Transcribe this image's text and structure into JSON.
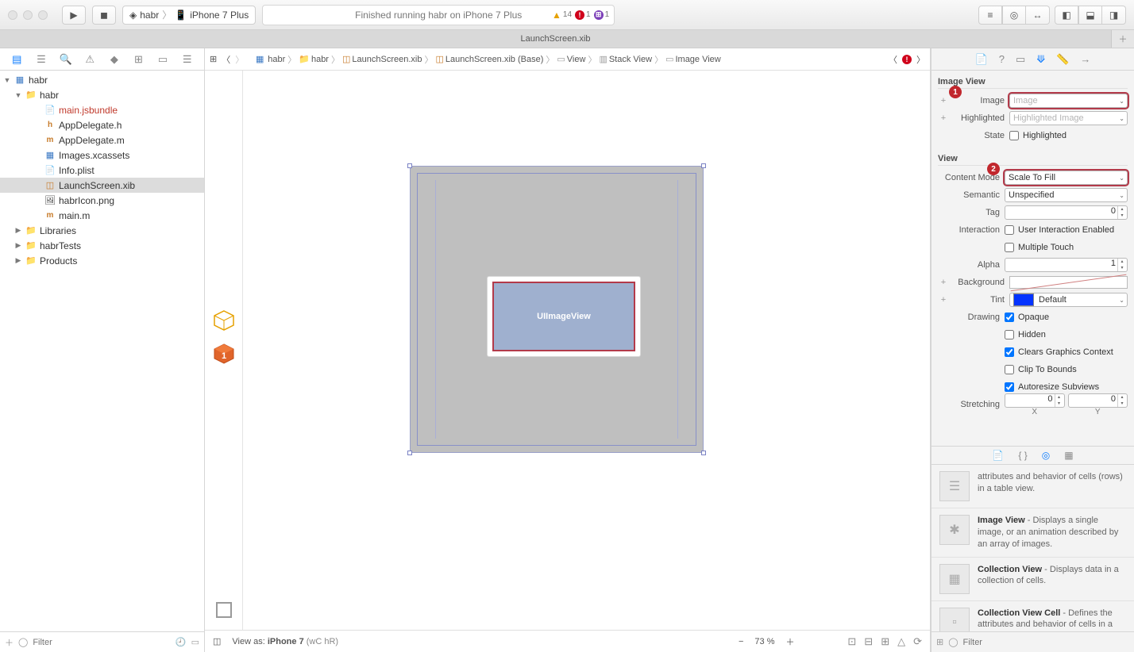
{
  "toolbar": {
    "scheme_target": "habr",
    "scheme_device": "iPhone 7 Plus",
    "activity_text": "Finished running habr on iPhone 7 Plus",
    "warn_count": "14",
    "error_count": "1",
    "test_count": "1"
  },
  "tab": {
    "title": "LaunchScreen.xib"
  },
  "jumpbar": {
    "proj": "habr",
    "folder": "habr",
    "file": "LaunchScreen.xib",
    "variant": "LaunchScreen.xib (Base)",
    "view": "View",
    "stack": "Stack View",
    "img": "Image View"
  },
  "navigator": {
    "root": "habr",
    "group_app": "habr",
    "files": {
      "jsbundle": "main.jsbundle",
      "appdelegate_h": "AppDelegate.h",
      "appdelegate_m": "AppDelegate.m",
      "images": "Images.xcassets",
      "info": "Info.plist",
      "launch": "LaunchScreen.xib",
      "icon": "habrIcon.png",
      "main_m": "main.m"
    },
    "groups": {
      "libraries": "Libraries",
      "tests": "habrTests",
      "products": "Products"
    },
    "filter_placeholder": "Filter"
  },
  "canvas": {
    "uiimageview_label": "UIImageView",
    "view_as_prefix": "View as: ",
    "view_as_device": "iPhone 7",
    "view_as_suffix": " (wC hR)",
    "zoom": "73 %"
  },
  "inspector": {
    "section_imageview": "Image View",
    "image_label": "Image",
    "image_placeholder": "Image",
    "highlighted_label": "Highlighted",
    "highlighted_placeholder": "Highlighted Image",
    "state_label": "State",
    "state_option": "Highlighted",
    "section_view": "View",
    "content_mode_label": "Content Mode",
    "content_mode_value": "Scale To Fill",
    "semantic_label": "Semantic",
    "semantic_value": "Unspecified",
    "tag_label": "Tag",
    "tag_value": "0",
    "interaction_label": "Interaction",
    "interaction_uie": "User Interaction Enabled",
    "interaction_mt": "Multiple Touch",
    "alpha_label": "Alpha",
    "alpha_value": "1",
    "background_label": "Background",
    "tint_label": "Tint",
    "tint_value": "Default",
    "drawing_label": "Drawing",
    "drawing_opts": {
      "opaque": "Opaque",
      "hidden": "Hidden",
      "clears": "Clears Graphics Context",
      "clip": "Clip To Bounds",
      "autoresize": "Autoresize Subviews"
    },
    "stretching_label": "Stretching",
    "stretch_x": "0",
    "stretch_y": "0",
    "stretch_x_lbl": "X",
    "stretch_y_lbl": "Y",
    "callout1": "1",
    "callout2": "2"
  },
  "library": {
    "item0_desc": "attributes and behavior of cells (rows) in a table view.",
    "item1_title": "Image View",
    "item1_desc": " - Displays a single image, or an animation described by an array of images.",
    "item2_title": "Collection View",
    "item2_desc": " - Displays data in a collection of cells.",
    "item3_title": "Collection View Cell",
    "item3_desc": " - Defines the attributes and behavior of cells in a collection view.",
    "filter_placeholder": "Filter"
  }
}
